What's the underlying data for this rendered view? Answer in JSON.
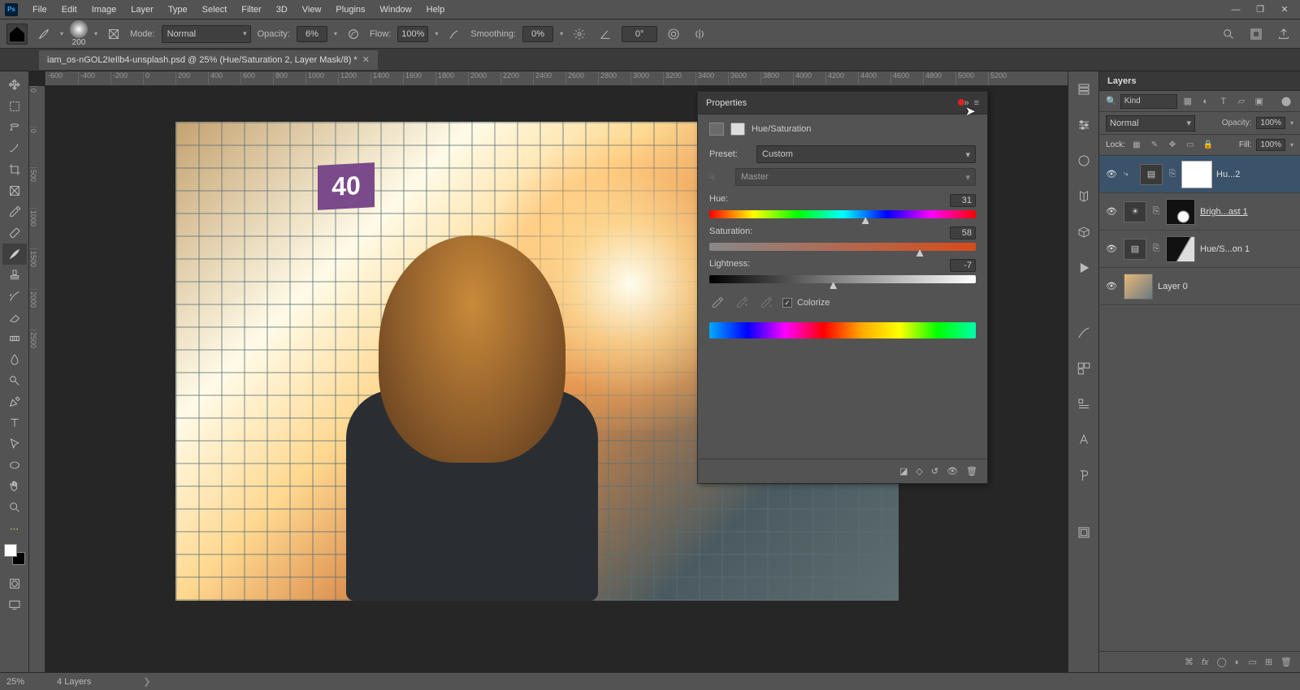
{
  "app": {
    "logo": "Ps"
  },
  "menu": [
    "File",
    "Edit",
    "Image",
    "Layer",
    "Type",
    "Select",
    "Filter",
    "3D",
    "View",
    "Plugins",
    "Window",
    "Help"
  ],
  "optbar": {
    "brush_size": "200",
    "mode_label": "Mode:",
    "mode_value": "Normal",
    "opacity_label": "Opacity:",
    "opacity_value": "6%",
    "flow_label": "Flow:",
    "flow_value": "100%",
    "smoothing_label": "Smoothing:",
    "smoothing_value": "0%",
    "angle": "0°"
  },
  "doc_tab": "iam_os-nGOL2IeIlb4-unsplash.psd @ 25% (Hue/Saturation 2, Layer Mask/8) *",
  "ruler_h": [
    -600,
    -400,
    -200,
    0,
    200,
    400,
    600,
    800,
    1000,
    1200,
    1400,
    1600,
    1800,
    2000,
    2200,
    2400,
    2600,
    2800,
    3000,
    3200,
    3400,
    3600,
    3800,
    4000,
    4200,
    4400,
    4600,
    4800,
    5000,
    5200
  ],
  "ruler_v": [
    0,
    0,
    500,
    1000,
    1500,
    2000,
    2500
  ],
  "sign_text": "40",
  "properties": {
    "title": "Properties",
    "adj_name": "Hue/Saturation",
    "preset_label": "Preset:",
    "preset_value": "Custom",
    "channel_value": "Master",
    "hue": {
      "label": "Hue:",
      "value": 31,
      "min": -180,
      "max": 180
    },
    "sat": {
      "label": "Saturation:",
      "value": 58,
      "min": -100,
      "max": 100
    },
    "light": {
      "label": "Lightness:",
      "value": -7,
      "min": -100,
      "max": 100
    },
    "colorize_label": "Colorize",
    "colorize_checked": true
  },
  "layers_panel": {
    "title": "Layers",
    "filter_kind": "Kind",
    "blend_mode": "Normal",
    "opacity_lbl": "Opacity:",
    "opacity_val": "100%",
    "lock_lbl": "Lock:",
    "fill_lbl": "Fill:",
    "fill_val": "100%",
    "items": [
      {
        "name": "Hu...2",
        "type": "huesat",
        "selected": true
      },
      {
        "name": "Brigh...ast 1",
        "type": "bright",
        "underline": true
      },
      {
        "name": "Hue/S...on 1",
        "type": "huesat2"
      },
      {
        "name": "Layer 0",
        "type": "image"
      }
    ]
  },
  "status": {
    "zoom": "25%",
    "info": "4 Layers"
  }
}
